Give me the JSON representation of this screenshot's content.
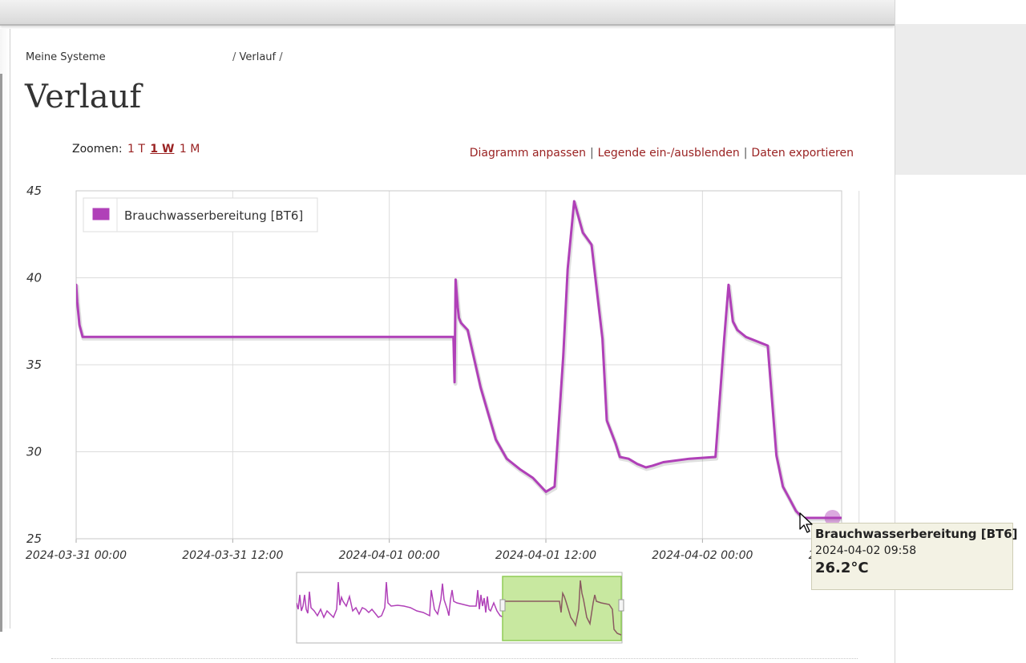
{
  "breadcrumb": {
    "items": [
      "Meine Systeme",
      "Verlauf"
    ],
    "separator": "/"
  },
  "page": {
    "title": "Verlauf"
  },
  "zoom": {
    "label": "Zoomen:",
    "options": [
      {
        "label": "1 T",
        "active": false
      },
      {
        "label": "1 W",
        "active": true
      },
      {
        "label": "1 M",
        "active": false
      }
    ]
  },
  "actions": {
    "customize": "Diagramm anpassen",
    "legend_toggle": "Legende ein-/ausblenden",
    "export": "Daten exportieren",
    "separator": "|"
  },
  "chart_data": {
    "type": "line",
    "series": [
      {
        "name": "Brauchwasserbereitung [BT6]",
        "color": "#b040b8",
        "x": [
          "2024-03-31 00:00",
          "2024-03-31 00:05",
          "2024-03-31 00:15",
          "2024-03-31 00:30",
          "2024-03-31 01:00",
          "2024-03-31 12:00",
          "2024-04-01 00:00",
          "2024-04-01 04:55",
          "2024-04-01 05:00",
          "2024-04-01 05:05",
          "2024-04-01 05:15",
          "2024-04-01 05:20",
          "2024-04-01 05:30",
          "2024-04-01 06:00",
          "2024-04-01 07:00",
          "2024-04-01 07:30",
          "2024-04-01 08:10",
          "2024-04-01 09:00",
          "2024-04-01 09:20",
          "2024-04-01 10:00",
          "2024-04-01 11:00",
          "2024-04-01 12:00",
          "2024-04-01 12:40",
          "2024-04-01 13:20",
          "2024-04-01 13:40",
          "2024-04-01 14:10",
          "2024-04-01 14:50",
          "2024-04-01 15:30",
          "2024-04-01 16:20",
          "2024-04-01 16:40",
          "2024-04-01 17:20",
          "2024-04-01 17:40",
          "2024-04-01 18:20",
          "2024-04-01 19:00",
          "2024-04-01 19:40",
          "2024-04-01 20:10",
          "2024-04-01 21:00",
          "2024-04-01 23:00",
          "2024-04-02 01:00",
          "2024-04-02 01:40",
          "2024-04-02 02:00",
          "2024-04-02 02:20",
          "2024-04-02 02:40",
          "2024-04-02 03:20",
          "2024-04-02 05:00",
          "2024-04-02 05:40",
          "2024-04-02 06:10",
          "2024-04-02 06:40",
          "2024-04-02 07:10",
          "2024-04-02 07:40",
          "2024-04-02 08:20",
          "2024-04-02 09:00",
          "2024-04-02 09:58",
          "2024-04-02 10:40"
        ],
        "y": [
          39.6,
          38.6,
          37.3,
          36.6,
          36.6,
          36.6,
          36.6,
          36.6,
          34.0,
          39.9,
          38.3,
          37.7,
          37.4,
          37.0,
          33.7,
          32.4,
          30.7,
          29.6,
          29.4,
          29.0,
          28.5,
          27.7,
          28.0,
          35.5,
          40.5,
          44.4,
          42.6,
          41.9,
          36.5,
          31.8,
          30.5,
          29.7,
          29.6,
          29.3,
          29.1,
          29.2,
          29.4,
          29.6,
          29.7,
          36.5,
          39.6,
          37.5,
          37.0,
          36.6,
          36.1,
          29.8,
          28.0,
          27.3,
          26.6,
          26.2,
          26.2,
          26.2,
          26.2,
          26.2
        ]
      }
    ],
    "xlim": [
      "2024-03-31 00:00",
      "2024-04-02 10:40"
    ],
    "ylim": [
      25,
      45
    ],
    "yticks": [
      25,
      30,
      35,
      40,
      45
    ],
    "xticks": [
      "2024-03-31 00:00",
      "2024-03-31 12:00",
      "2024-04-01 00:00",
      "2024-04-01 12:00",
      "2024-04-02 00:00",
      "2024-04-02 12:00"
    ],
    "grid": true,
    "legend": "top-left",
    "navigator": {
      "selection_color": "#c8e8a0",
      "selection_range": [
        0.63,
        1.0
      ]
    }
  },
  "tooltip": {
    "series": "Brauchwasserbereitung [BT6]",
    "time": "2024-04-02 09:58",
    "value": "26.2°C"
  }
}
